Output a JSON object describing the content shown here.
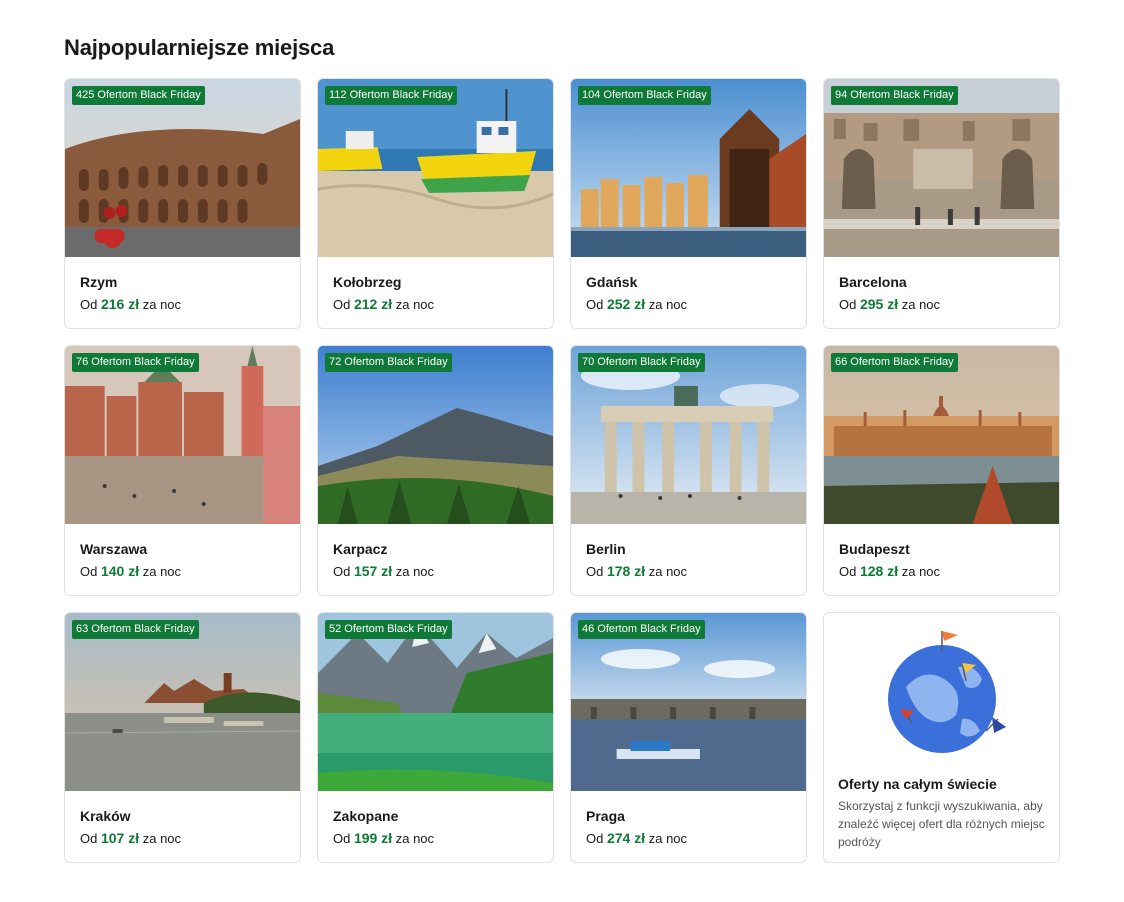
{
  "section": {
    "title": "Najpopularniejsze miejsca"
  },
  "labels": {
    "from": "Od",
    "currency": "zł",
    "per_night": "za noc"
  },
  "colors": {
    "badge": "#0f7a37",
    "price": "#0f7a37"
  },
  "destinations": [
    {
      "city": "Rzym",
      "badge": "425 Ofertom Black Friday",
      "price": "216"
    },
    {
      "city": "Kołobrzeg",
      "badge": "112 Ofertom Black Friday",
      "price": "212"
    },
    {
      "city": "Gdańsk",
      "badge": "104 Ofertom Black Friday",
      "price": "252"
    },
    {
      "city": "Barcelona",
      "badge": "94 Ofertom Black Friday",
      "price": "295"
    },
    {
      "city": "Warszawa",
      "badge": "76 Ofertom Black Friday",
      "price": "140"
    },
    {
      "city": "Karpacz",
      "badge": "72 Ofertom Black Friday",
      "price": "157"
    },
    {
      "city": "Berlin",
      "badge": "70 Ofertom Black Friday",
      "price": "178"
    },
    {
      "city": "Budapeszt",
      "badge": "66 Ofertom Black Friday",
      "price": "128"
    },
    {
      "city": "Kraków",
      "badge": "63 Ofertom Black Friday",
      "price": "107"
    },
    {
      "city": "Zakopane",
      "badge": "52 Ofertom Black Friday",
      "price": "199"
    },
    {
      "city": "Praga",
      "badge": "46 Ofertom Black Friday",
      "price": "274"
    }
  ],
  "promo": {
    "title": "Oferty na całym świecie",
    "description": "Skorzystaj z funkcji wyszukiwania, aby znaleźć więcej ofert dla różnych miejsc podróży",
    "icon": "globe-with-flags-icon"
  }
}
